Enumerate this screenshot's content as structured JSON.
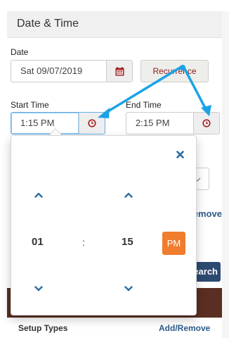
{
  "section": {
    "title": "Date & Time"
  },
  "date": {
    "label": "Date",
    "value": "Sat 09/07/2019"
  },
  "recurrence": {
    "label": "Recurrence"
  },
  "start_time": {
    "label": "Start Time",
    "value": "1:15 PM"
  },
  "end_time": {
    "label": "End Time",
    "value": "2:15 PM"
  },
  "background": {
    "add_remove": "Add/Remove",
    "search": "Search"
  },
  "timepicker": {
    "hour": "01",
    "separator": ":",
    "minute": "15",
    "meridian": "PM"
  },
  "setup_types": {
    "label": "Setup Types",
    "add_remove": "Add/Remove"
  },
  "colors": {
    "accent_orange": "#f07c2d",
    "arrow_blue": "#1aa3e6",
    "link_blue": "#2d5a88",
    "clock_red": "#a31f1f"
  }
}
